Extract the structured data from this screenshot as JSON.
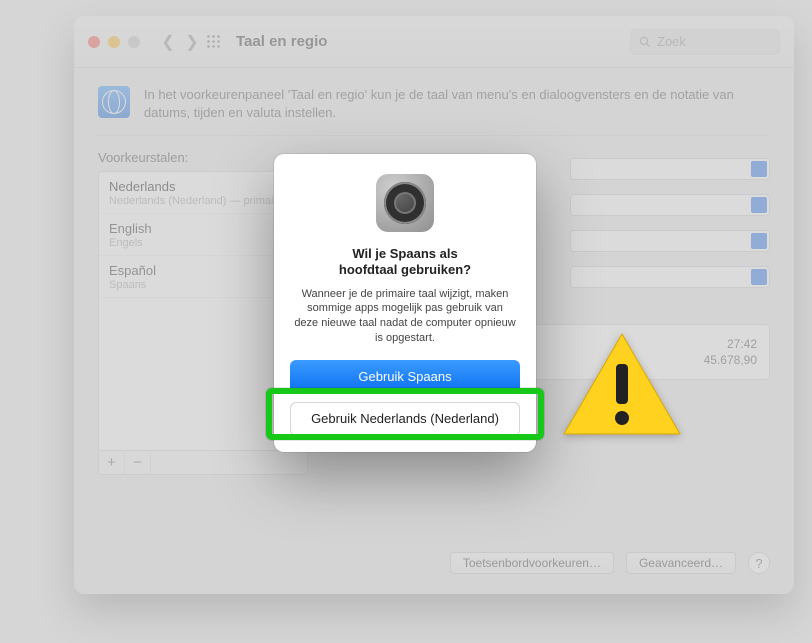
{
  "window": {
    "title": "Taal en regio",
    "search_placeholder": "Zoek"
  },
  "header": {
    "description": "In het voorkeurenpaneel 'Taal en regio' kun je de taal van menu's en dialoogvensters en de notatie van datums, tijden en valuta instellen."
  },
  "left_panel": {
    "label": "Voorkeurstalen:",
    "languages": [
      {
        "name": "Nederlands",
        "sub": "Nederlands (Nederland) — primair"
      },
      {
        "name": "English",
        "sub": "Engels"
      },
      {
        "name": "Español",
        "sub": "Spaans"
      }
    ]
  },
  "example": {
    "line1": "27:42",
    "line2": "45.678,90"
  },
  "footer": {
    "keyboard": "Toetsenbordvoorkeuren…",
    "advanced": "Geavanceerd…",
    "help": "?"
  },
  "dialog": {
    "title_line1": "Wil je Spaans als",
    "title_line2": "hoofdtaal gebruiken?",
    "message": "Wanneer je de primaire taal wijzigt, maken sommige apps mogelijk pas gebruik van deze nieuwe taal nadat de computer opnieuw is opgestart.",
    "primary_btn": "Gebruik Spaans",
    "secondary_btn": "Gebruik Nederlands (Nederland)"
  }
}
